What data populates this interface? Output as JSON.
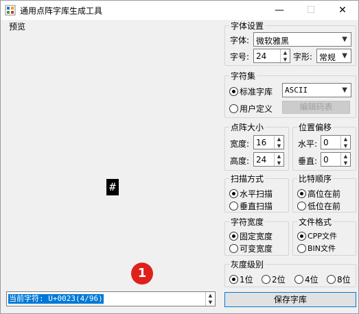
{
  "window": {
    "title": "通用点阵字库生成工具",
    "minimize": "—",
    "maximize": "☐",
    "close": "✕"
  },
  "preview": {
    "label": "预览",
    "char": "#",
    "badge": "1"
  },
  "status": {
    "text": "当前字符: U+0023(4/96)"
  },
  "font_settings": {
    "title": "字体设置",
    "font_label": "字体:",
    "font_value": "微软雅黑",
    "size_label": "字号:",
    "size_value": "24",
    "style_label": "字形:",
    "style_value": "常规"
  },
  "charset": {
    "title": "字符集",
    "standard_label": "标准字库",
    "standard_value": "ASCII",
    "user_label": "用户定义",
    "edit_button": "编辑码表"
  },
  "matrix_size": {
    "title": "点阵大小",
    "width_label": "宽度:",
    "width_value": "16",
    "height_label": "高度:",
    "height_value": "24"
  },
  "offset": {
    "title": "位置偏移",
    "h_label": "水平:",
    "h_value": "0",
    "v_label": "垂直:",
    "v_value": "0"
  },
  "scan": {
    "title": "扫描方式",
    "horizontal": "水平扫描",
    "vertical": "垂直扫描"
  },
  "bit_order": {
    "title": "比特顺序",
    "msb": "高位在前",
    "lsb": "低位在前"
  },
  "char_width": {
    "title": "字符宽度",
    "fixed": "固定宽度",
    "variable": "可变宽度"
  },
  "file_format": {
    "title": "文件格式",
    "cpp": "CPP文件",
    "bin": "BIN文件"
  },
  "gray_level": {
    "title": "灰度级别",
    "options": [
      "1位",
      "2位",
      "4位",
      "8位"
    ]
  },
  "save_button": "保存字库"
}
